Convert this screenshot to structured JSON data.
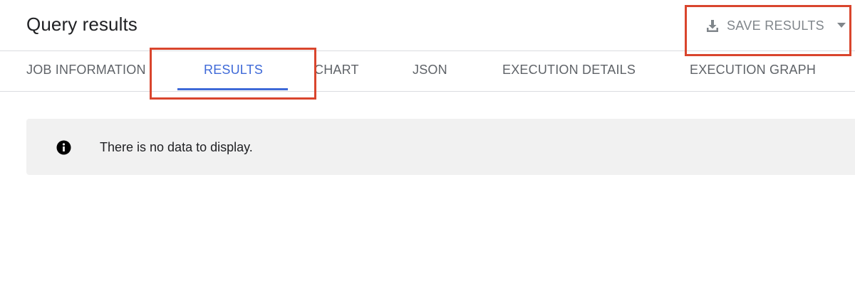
{
  "header": {
    "title": "Query results",
    "save_button": {
      "label": "SAVE RESULTS",
      "icon": "download-icon",
      "dropdown_icon": "caret-down-icon"
    }
  },
  "tabs": [
    {
      "label": "JOB INFORMATION",
      "active": false
    },
    {
      "label": "RESULTS",
      "active": true
    },
    {
      "label": "CHART",
      "active": false
    },
    {
      "label": "JSON",
      "active": false
    },
    {
      "label": "EXECUTION DETAILS",
      "active": false
    },
    {
      "label": "EXECUTION GRAPH",
      "active": false
    }
  ],
  "notice": {
    "icon": "info-icon",
    "message": "There is no data to display."
  },
  "colors": {
    "accent": "#3f6ad8",
    "highlight": "#d9452d",
    "muted": "#80868b",
    "notice_bg": "#f1f1f1"
  }
}
